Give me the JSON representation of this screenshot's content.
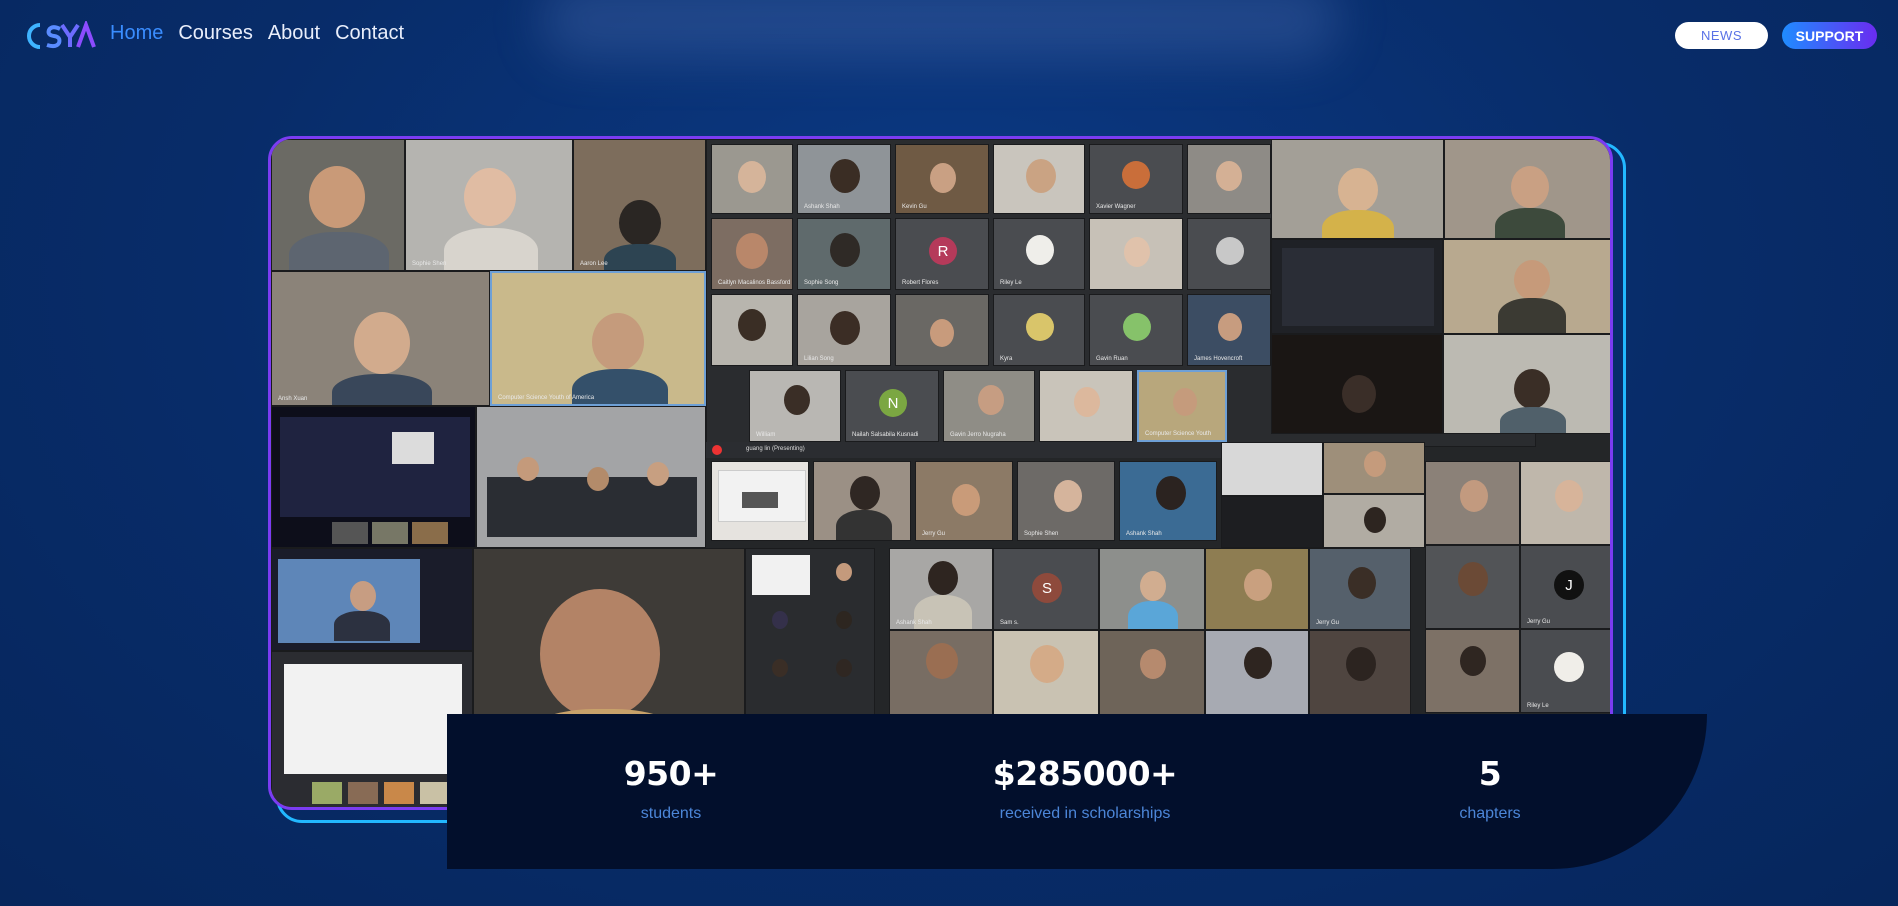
{
  "header": {
    "logo_text": "OSYA",
    "nav": [
      {
        "label": "Home",
        "active": true
      },
      {
        "label": "Courses",
        "active": false
      },
      {
        "label": "About",
        "active": false
      },
      {
        "label": "Contact",
        "active": false
      }
    ],
    "news_button": "NEWS",
    "support_button": "SUPPORT"
  },
  "collage": {
    "participant_labels": [
      "Sophie Shen",
      "Aaron Lee",
      "Ashank Shah",
      "Kevin Gu",
      "Xavier Wagner",
      "Caitlyn Macalinos Bassford",
      "Gavin Ruan",
      "Robert Flores",
      "Riley Le",
      "Kyra",
      "James Hovencroft",
      "William",
      "Nailah Salsabila Kusnadi",
      "Gavin Jerro Nugraha",
      "Computer Science Youth",
      "Sophie Shen",
      "Ashank Shah",
      "guang lin (Presenting)",
      "Sam s.",
      "Jerry Gu",
      "Ansh Xuan",
      "Computer Science Youth of America",
      "Sophie Song",
      "Lilian Song",
      "Jerry Gu",
      "Riley Le"
    ],
    "avatar_letters": [
      "R",
      "N",
      "S",
      "J"
    ],
    "accent_colors": {
      "frame_inner": "#7b3cf2",
      "frame_outer": "#22b8ff"
    }
  },
  "stats": [
    {
      "value": "950+",
      "label": "students"
    },
    {
      "value": "$285000+",
      "label": "received in scholarships"
    },
    {
      "value": "5",
      "label": "chapters"
    }
  ],
  "colors": {
    "background": "#082c69",
    "nav_active": "#3a8dff",
    "stats_panel": "#020f2c",
    "stat_caption": "#4c86d8"
  }
}
